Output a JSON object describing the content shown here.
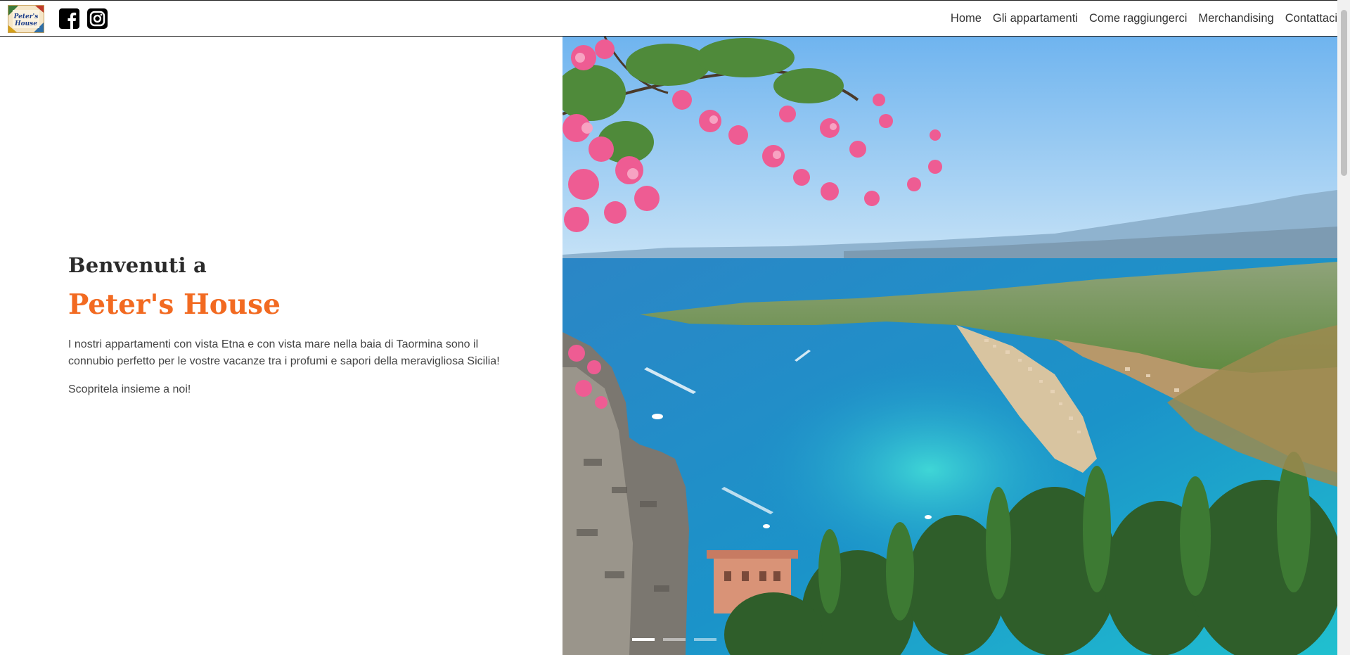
{
  "brand": {
    "logo_text": "Peter's House"
  },
  "social": [
    {
      "name": "facebook"
    },
    {
      "name": "instagram"
    }
  ],
  "nav": {
    "items": [
      {
        "label": "Home"
      },
      {
        "label": "Gli appartamenti"
      },
      {
        "label": "Come raggiungerci"
      },
      {
        "label": "Merchandising"
      },
      {
        "label": "Contattaci"
      }
    ]
  },
  "hero": {
    "welcome": "Benvenuti a",
    "title": "Peter's House",
    "intro": "I nostri appartamenti con vista Etna e con vista mare nella baia di Taormina sono il connubio perfetto per le vostre vacanze tra i profumi e sapori della meravigliosa Sicilia!",
    "cta": "Scopritela insieme a noi!"
  },
  "carousel": {
    "slides": 3,
    "active_index": 0,
    "image_icon": "taormina-bay-photo"
  },
  "colors": {
    "accent": "#f26a21",
    "text": "#333333",
    "heading": "#2b2b2b",
    "background": "#ffffff"
  }
}
